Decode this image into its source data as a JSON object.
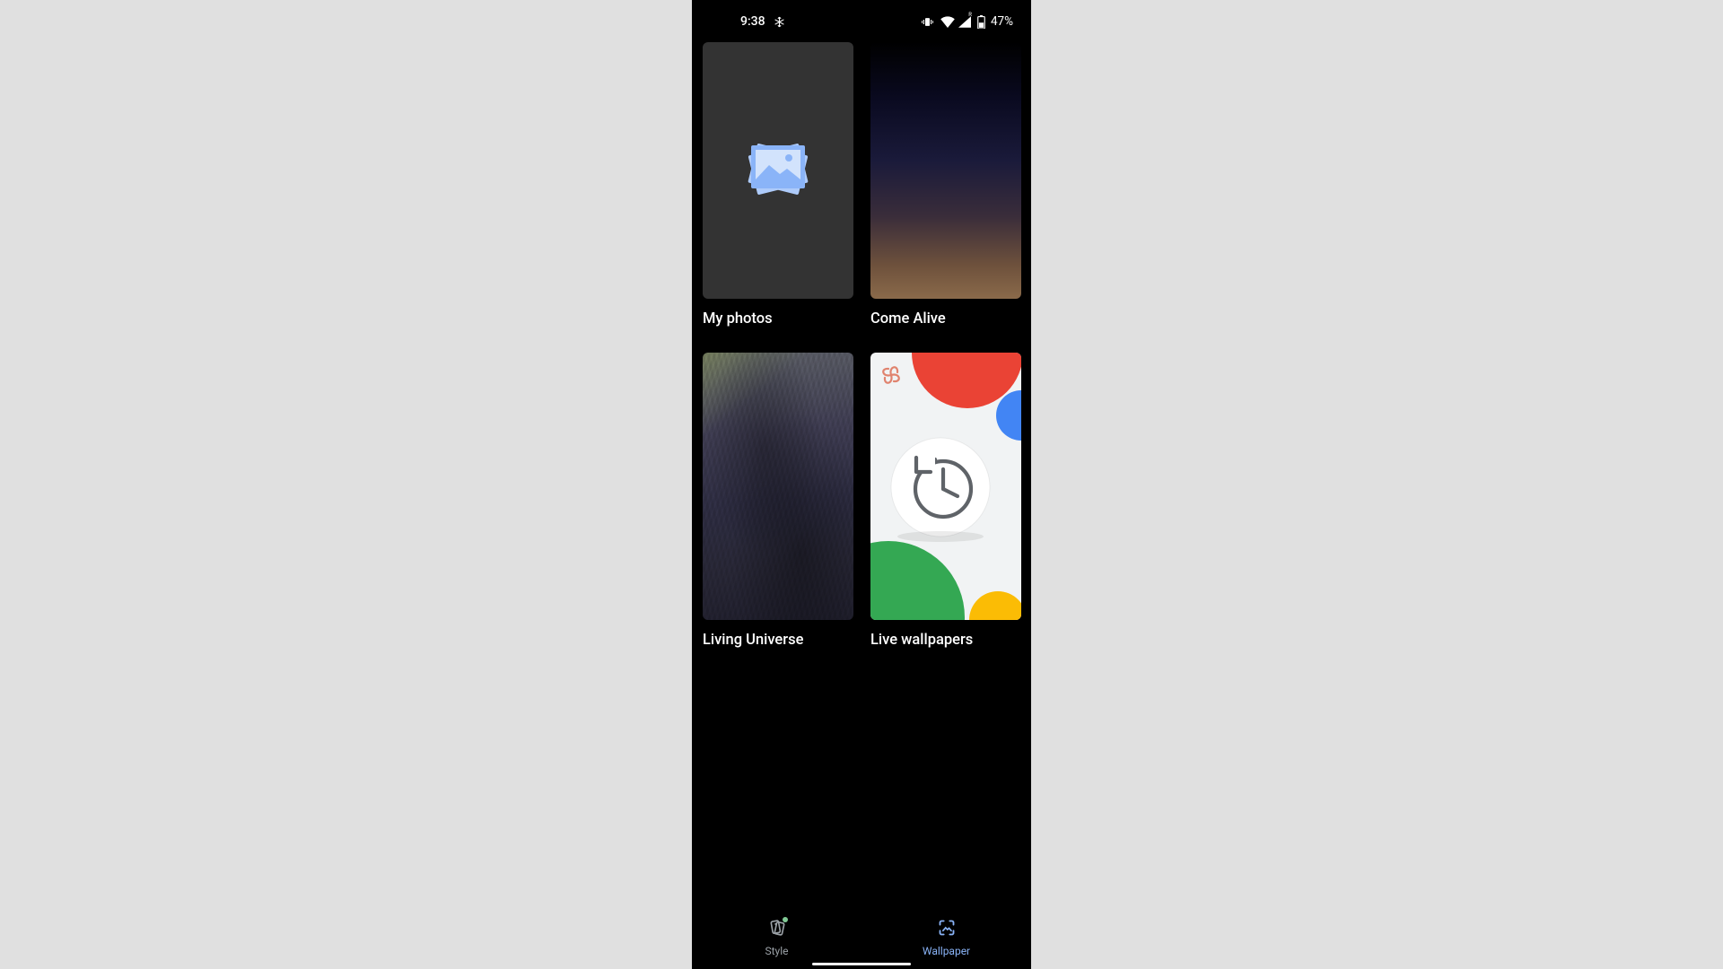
{
  "status": {
    "time": "9:38",
    "battery_text": "47%"
  },
  "categories": [
    {
      "label": "My photos"
    },
    {
      "label": "Come Alive"
    },
    {
      "label": "Living Universe"
    },
    {
      "label": "Live wallpapers"
    }
  ],
  "nav": {
    "style": "Style",
    "wallpaper": "Wallpaper"
  },
  "colors": {
    "accent_blue": "#8ab4f8",
    "google_red": "#ea4335",
    "google_blue": "#4285f4",
    "google_green": "#34a853",
    "google_yellow": "#fbbc05"
  }
}
